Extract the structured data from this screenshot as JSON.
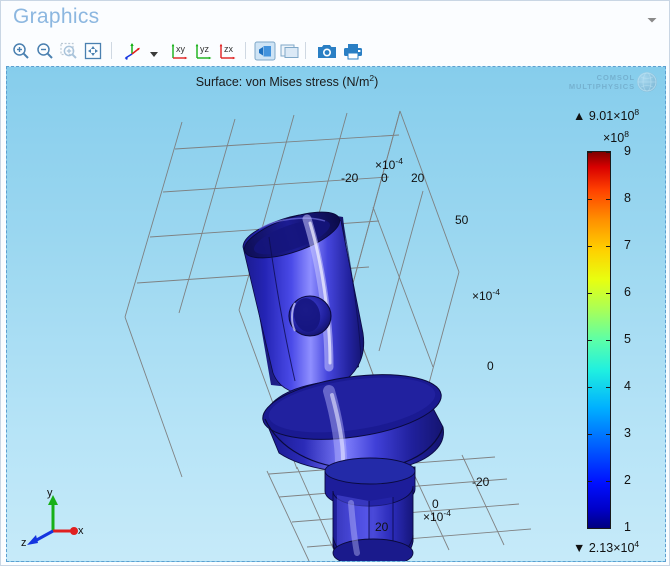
{
  "window": {
    "panel_title": "Graphics",
    "menu_icon": "chevron-down-icon"
  },
  "toolbar": {
    "buttons": [
      {
        "name": "zoom-in-button",
        "icon": "zoom-in-icon",
        "tooltip": "Zoom In"
      },
      {
        "name": "zoom-out-button",
        "icon": "zoom-out-icon",
        "tooltip": "Zoom Out"
      },
      {
        "name": "zoom-box-button",
        "icon": "zoom-box-icon",
        "tooltip": "Zoom Box"
      },
      {
        "name": "zoom-extents-button",
        "icon": "zoom-extents-icon",
        "tooltip": "Zoom Extents"
      },
      {
        "name": "go-to-default-view-button",
        "icon": "axis-triad-icon",
        "tooltip": "Go to Default 3D View"
      },
      {
        "name": "view-menu-caret",
        "icon": "caret-down-icon",
        "tooltip": "View Options"
      },
      {
        "name": "go-to-xy-view-button",
        "icon": "xy-axes-icon",
        "tooltip": "Go to XY View"
      },
      {
        "name": "go-to-yz-view-button",
        "icon": "yz-axes-icon",
        "tooltip": "Go to YZ View"
      },
      {
        "name": "go-to-zx-view-button",
        "icon": "zx-axes-icon",
        "tooltip": "Go to ZX View"
      },
      {
        "name": "transparency-button",
        "icon": "transparency-icon",
        "tooltip": "Transparency"
      },
      {
        "name": "select-all-button",
        "icon": "layers-icon",
        "tooltip": "Scene Light"
      },
      {
        "name": "image-snapshot-button",
        "icon": "camera-icon",
        "tooltip": "Image Snapshot"
      },
      {
        "name": "print-button",
        "icon": "printer-icon",
        "tooltip": "Print"
      }
    ]
  },
  "watermark": {
    "line1": "COMSOL",
    "line2": "MULTIPHYSICS",
    "globe_icon": "globe-icon"
  },
  "chart_data": {
    "type": "heatmap",
    "title": "Surface: von Mises stress (N/m",
    "title_sup": "2",
    "title_tail": ")",
    "title_full": "Surface: von Mises stress (N/m^2)",
    "plot_kind": "3d-surface-stress-plot",
    "geometry_description": "dental implant abutment assembly",
    "surface_color_hex": "#2222bb",
    "background_top_hex": "#86cdec",
    "background_bottom_hex": "#c6eaf9",
    "grid": true,
    "grid_color_hex": "#7a7a7a",
    "axes": {
      "top": {
        "unit_exponent_mantissa": "×10",
        "unit_exponent": "-4",
        "ticks": [
          "-20",
          "0",
          "20"
        ]
      },
      "right": {
        "unit_exponent_mantissa": "×10",
        "unit_exponent": "-4",
        "ticks": [
          "50",
          "0"
        ]
      },
      "bottom": {
        "unit_exponent_mantissa": "×10",
        "unit_exponent": "-4",
        "ticks": [
          "-20",
          "0",
          "20"
        ]
      }
    },
    "legend": {
      "max_prefix": "▲",
      "max_value": "9.01×10",
      "max_exponent": "8",
      "min_prefix": "▼",
      "min_value": "2.13×10",
      "min_exponent": "4",
      "scale_mantissa": "×10",
      "scale_exponent": "8",
      "ticks": [
        "9",
        "8",
        "7",
        "6",
        "5",
        "4",
        "3",
        "2",
        "1"
      ],
      "tick_values": [
        9,
        8,
        7,
        6,
        5,
        4,
        3,
        2,
        1
      ],
      "colormap": "jet",
      "range_min": 21300,
      "range_max": 901000000,
      "unit": "N/m^2"
    }
  },
  "triad": {
    "x_label": "x",
    "y_label": "y",
    "z_label": "z",
    "x_color": "#e02020",
    "y_color": "#17b017",
    "z_color": "#1535e0"
  }
}
